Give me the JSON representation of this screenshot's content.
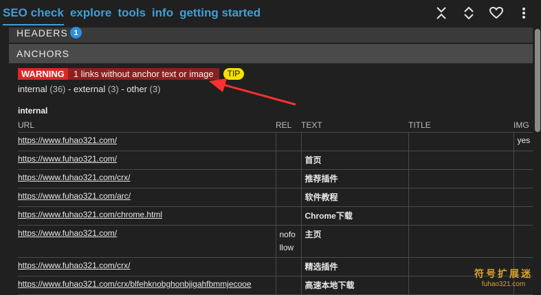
{
  "nav": {
    "tabs": [
      "SEO check",
      "explore",
      "tools",
      "info",
      "getting started"
    ]
  },
  "icons": {
    "collapse": "collapse-all-icon",
    "expand": "expand-all-icon",
    "favorite": "heart-icon",
    "more": "more-vertical-icon"
  },
  "sections": {
    "headers_label": "HEADERS",
    "headers_count": "1",
    "anchors_label": "ANCHORS"
  },
  "warning": {
    "label": "WARNING",
    "text": "1 links without anchor text or image",
    "tip": "TIP"
  },
  "counts": {
    "internal_label": "internal",
    "internal_count": "(36)",
    "sep1": " - ",
    "external_label": "external",
    "external_count": "(3)",
    "sep2": " - ",
    "other_label": "other",
    "other_count": "(3)"
  },
  "group_title": "internal",
  "table": {
    "headers": [
      "URL",
      "REL",
      "TEXT",
      "TITLE",
      "IMG"
    ],
    "rows": [
      {
        "url": "https://www.fuhao321.com/",
        "rel": "",
        "text": "",
        "title": "",
        "img": "yes"
      },
      {
        "url": "https://www.fuhao321.com/",
        "rel": "",
        "text": "首页",
        "title": "",
        "img": ""
      },
      {
        "url": "https://www.fuhao321.com/crx/",
        "rel": "",
        "text": "推荐插件",
        "title": "",
        "img": ""
      },
      {
        "url": "https://www.fuhao321.com/arc/",
        "rel": "",
        "text": "软件教程",
        "title": "",
        "img": ""
      },
      {
        "url": "https://www.fuhao321.com/chrome.html",
        "rel": "",
        "text": "Chrome下载",
        "title": "",
        "img": ""
      },
      {
        "url": "https://www.fuhao321.com/",
        "rel": "nofollow",
        "rel_line1": "nofo",
        "rel_line2": "llow",
        "text": "主页",
        "title": "",
        "img": ""
      },
      {
        "url": "https://www.fuhao321.com/crx/",
        "rel": "",
        "text": "精选插件",
        "title": "",
        "img": ""
      },
      {
        "url": "https://www.fuhao321.com/crx/blfehknobghonbjigahfbmmjecooe",
        "rel": "",
        "text": "高速本地下载",
        "title": "",
        "img": ""
      }
    ]
  },
  "watermark": {
    "cn": "符号扩展迷",
    "en": "fuhao321.com"
  },
  "colors": {
    "accent": "#3f9fd8",
    "warning": "#d72727",
    "tip": "#f5e100",
    "badge": "#2f8ee0"
  }
}
